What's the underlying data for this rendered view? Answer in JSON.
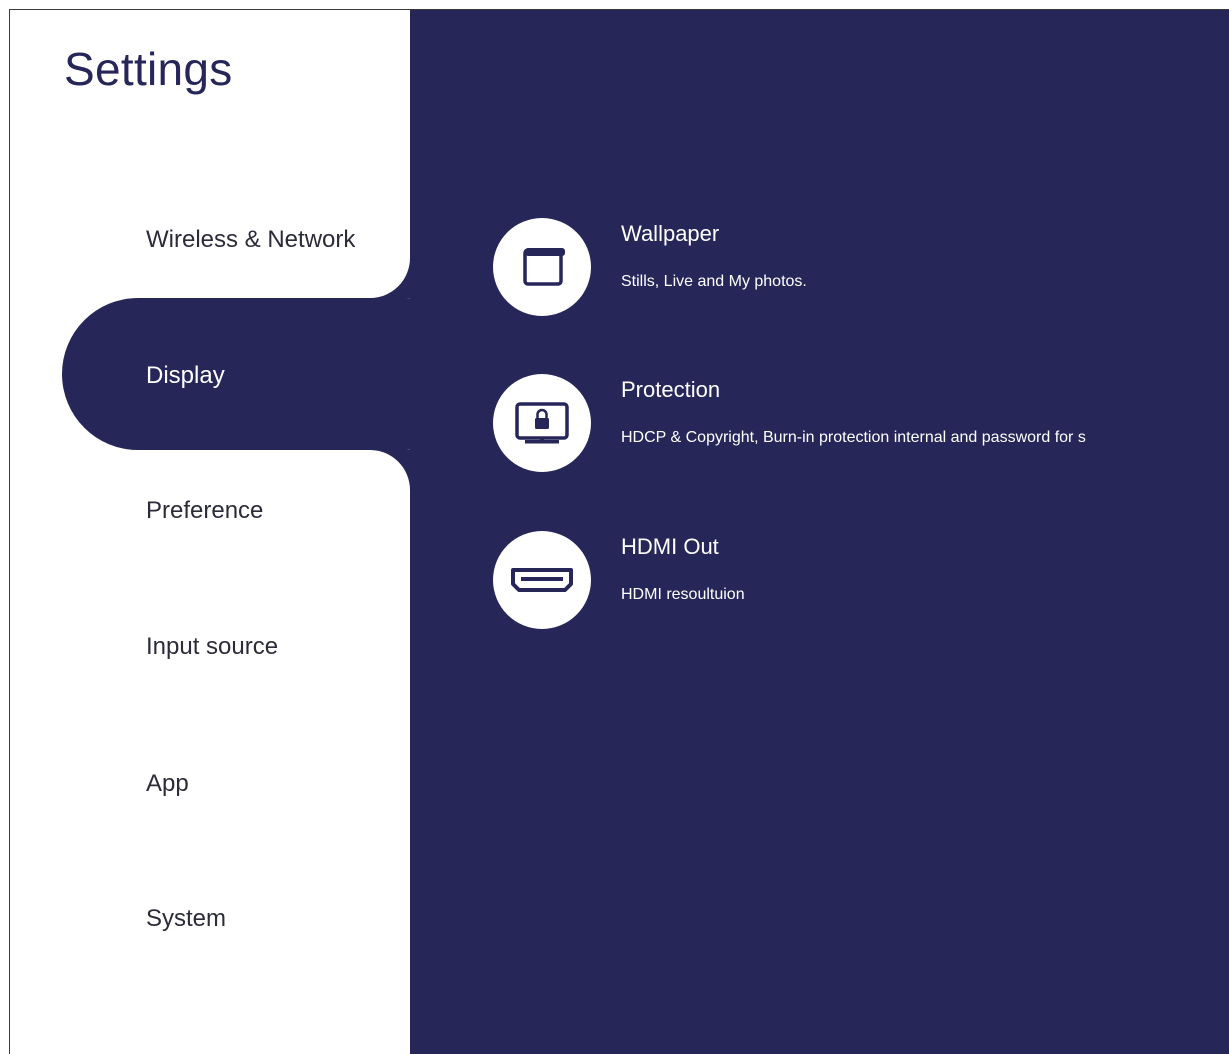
{
  "app": {
    "title": "Settings"
  },
  "sidebar": {
    "items": [
      {
        "label": "Wireless & Network",
        "selected": false
      },
      {
        "label": "Display",
        "selected": true
      },
      {
        "label": "Preference",
        "selected": false
      },
      {
        "label": "Input source",
        "selected": false
      },
      {
        "label": "App",
        "selected": false
      },
      {
        "label": "System",
        "selected": false
      }
    ]
  },
  "display": {
    "options": [
      {
        "title": "Wallpaper",
        "description": "Stills, Live and My photos.",
        "icon": "wallpaper-icon"
      },
      {
        "title": "Protection",
        "description": "HDCP & Copyright, Burn-in protection internal and password for s",
        "icon": "monitor-lock-icon"
      },
      {
        "title": "HDMI Out",
        "description": "HDMI resoultuion",
        "icon": "hdmi-port-icon"
      }
    ]
  },
  "colors": {
    "accent": "#262659",
    "background": "#ffffff",
    "text_dark": "#2b2b3a",
    "text_light": "#ffffff"
  }
}
